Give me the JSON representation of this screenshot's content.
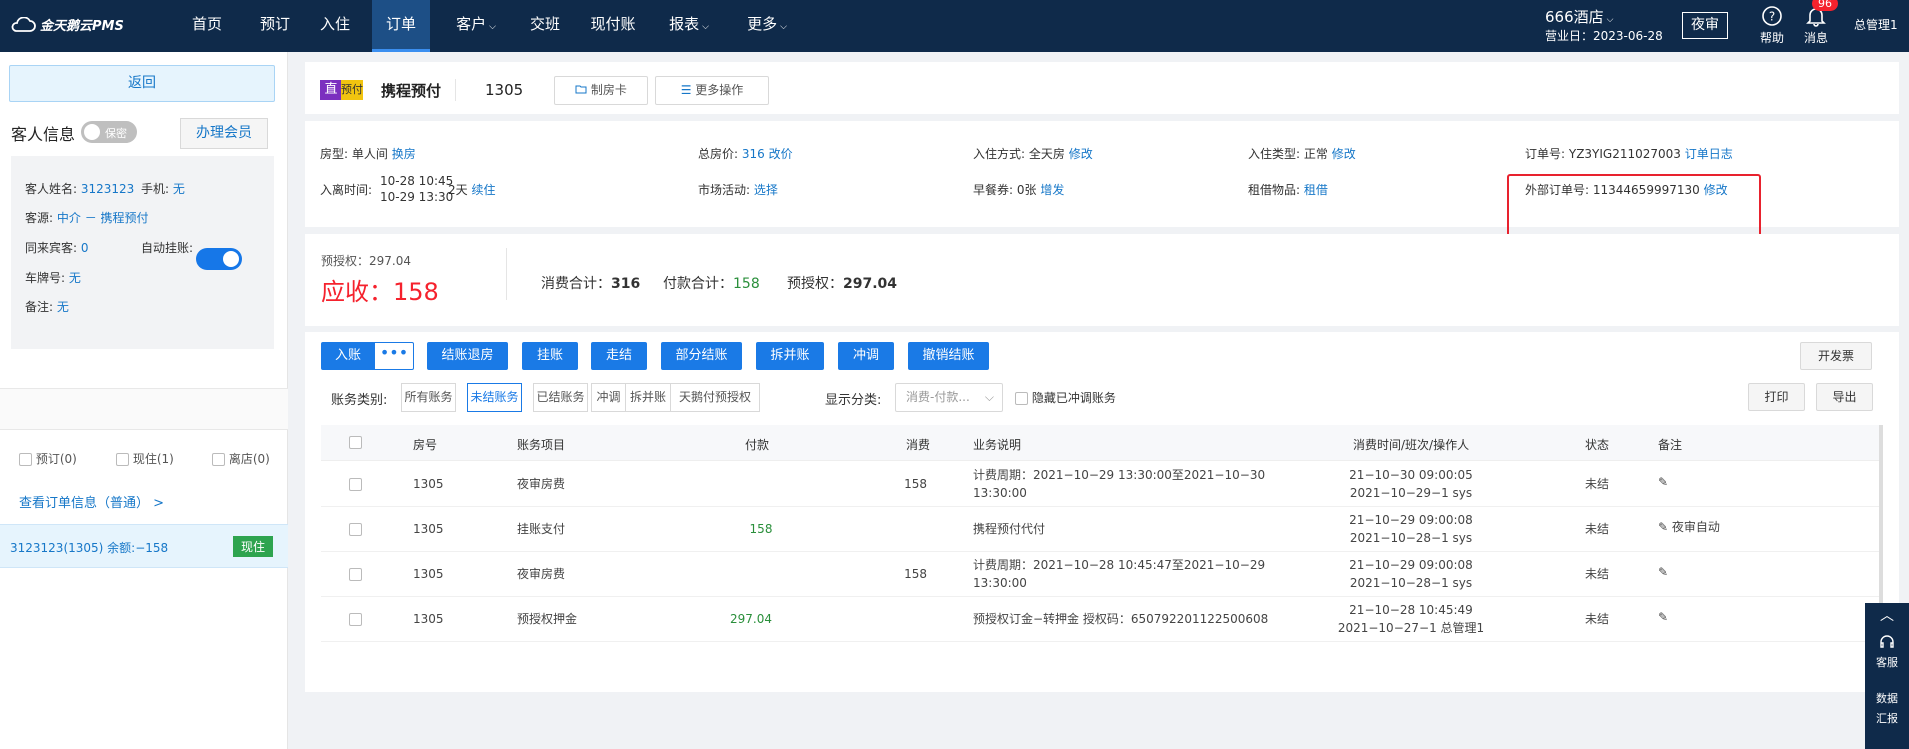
{
  "nav": {
    "logo": "金天鹅云PMS",
    "items": [
      "首页",
      "预订",
      "入住",
      "订单",
      "客户",
      "交班",
      "现付账",
      "报表",
      "更多"
    ],
    "active": "订单",
    "hotel": "666酒店",
    "biz_date": "营业日：2023-06-28",
    "night_audit": "夜审",
    "help": "帮助",
    "messages": "消息",
    "msg_count": "96",
    "admin": "总管理1"
  },
  "sidebar": {
    "back": "返回",
    "guest_title": "客人信息",
    "privacy": "保密",
    "member_btn": "办理会员",
    "name_label": "客人姓名:",
    "name": "3123123",
    "phone_label": "手机:",
    "phone": "无",
    "source_label": "客源:",
    "source": "中介 － 携程预付",
    "companions_label": "同来宾客:",
    "companions": "0",
    "auto_hang_label": "自动挂账:",
    "plate_label": "车牌号:",
    "plate": "无",
    "remark_label": "备注:",
    "remark": "无",
    "filters": [
      "预订(0)",
      "现住(1)",
      "离店(0)"
    ],
    "view_order": "查看订单信息（普通）  >",
    "room_row": "3123123(1305)  余额:−158",
    "room_status": "现住"
  },
  "header": {
    "tag_direct": "直",
    "tag_prepay": "预付",
    "channel": "携程预付",
    "room": "1305",
    "btn_card": "制房卡",
    "btn_more": "更多操作"
  },
  "info": {
    "room_type_label": "房型:",
    "room_type": "单人间",
    "room_type_link": "换房",
    "total_label": "总房价:",
    "total": "316",
    "total_link": "改价",
    "checkin_mode_label": "入住方式:",
    "checkin_mode": "全天房",
    "checkin_mode_link": "修改",
    "checkin_type_label": "入住类型:",
    "checkin_type": "正常",
    "checkin_type_link": "修改",
    "order_no_label": "订单号:",
    "order_no": "YZ3YIG211027003",
    "order_log": "订单日志",
    "stay_label": "入离时间:",
    "stay_in": "10-28 10:45",
    "stay_out": "10-29 13:30",
    "nights": "2天",
    "extend": "续住",
    "market_label": "市场活动:",
    "market_link": "选择",
    "breakfast_label": "早餐券:",
    "breakfast": "0张",
    "breakfast_link": "增发",
    "rent_label": "租借物品:",
    "rent_link": "租借",
    "ext_no_label": "外部订单号:",
    "ext_no": "11344659997130",
    "ext_link": "修改"
  },
  "totals": {
    "preauth_small": "预授权：297.04",
    "due": "应收：158",
    "consume_label": "消费合计：",
    "consume": "316",
    "pay_label": "付款合计：",
    "pay": "158",
    "preauth_label": "预授权：",
    "preauth": "297.04"
  },
  "actions": {
    "post": "入账",
    "dots": "•••",
    "buttons": [
      "结账退房",
      "挂账",
      "走结",
      "部分结账",
      "拆并账",
      "冲调",
      "撤销结账"
    ],
    "invoice": "开发票",
    "print": "打印",
    "export": "导出",
    "acct_label": "账务类别:",
    "segments": [
      "所有账务",
      "未结账务",
      "已结账务",
      "冲调",
      "拆并账",
      "天鹅付预授权"
    ],
    "seg_active": "未结账务",
    "disp_label": "显示分类:",
    "disp_value": "消费-付款...",
    "hide_label": "隐藏已冲调账务"
  },
  "table": {
    "headers": [
      "房号",
      "账务项目",
      "付款",
      "消费",
      "业务说明",
      "消费时间/班次/操作人",
      "状态",
      "备注"
    ],
    "rows": [
      {
        "room": "1305",
        "item": "夜审房费",
        "pay": "",
        "consume": "158",
        "desc1": "计费周期：2021−10−29 13:30:00至2021−10−30",
        "desc2": "13:30:00",
        "t1": "21−10−30 09:00:05",
        "t2": "2021−10−29−1 sys",
        "status": "未结",
        "note": ""
      },
      {
        "room": "1305",
        "item": "挂账支付",
        "pay": "158",
        "consume": "",
        "desc1": "携程预付代付",
        "desc2": "",
        "t1": "21−10−29 09:00:08",
        "t2": "2021−10−28−1 sys",
        "status": "未结",
        "note": "夜审自动"
      },
      {
        "room": "1305",
        "item": "夜审房费",
        "pay": "",
        "consume": "158",
        "desc1": "计费周期：2021−10−28 10:45:47至2021−10−29",
        "desc2": "13:30:00",
        "t1": "21−10−29 09:00:08",
        "t2": "2021−10−28−1 sys",
        "status": "未结",
        "note": ""
      },
      {
        "room": "1305",
        "item": "预授权押金",
        "pay": "297.04",
        "consume": "",
        "desc1": "预授权订金−转押金 授权码：650792201122500608",
        "desc2": "",
        "t1": "21−10−28 10:45:49",
        "t2": "2021−10−27−1 总管理1",
        "status": "未结",
        "note": ""
      }
    ]
  },
  "floater": {
    "service": "客服",
    "data1": "数据",
    "data2": "汇报"
  }
}
